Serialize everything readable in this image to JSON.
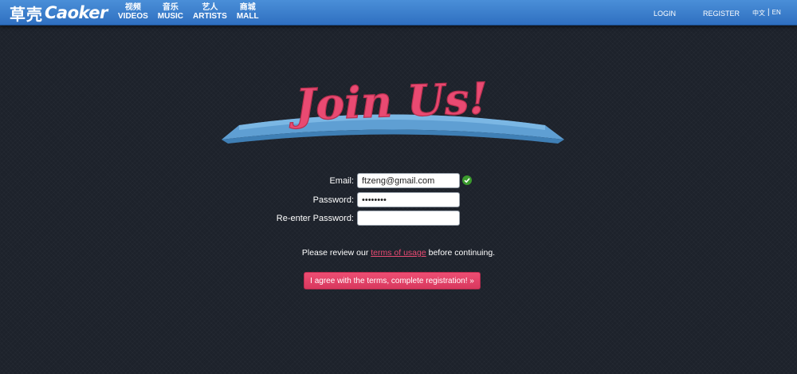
{
  "header": {
    "logo_cn": "草壳",
    "logo_en": "Caoker",
    "nav": [
      {
        "cn": "视频",
        "en": "VIDEOS"
      },
      {
        "cn": "音乐",
        "en": "MUSIC"
      },
      {
        "cn": "艺人",
        "en": "ARTISTS"
      },
      {
        "cn": "商城",
        "en": "MALL"
      }
    ],
    "login": "LOGIN",
    "register": "REGISTER",
    "lang_cn": "中文",
    "lang_sep": "|",
    "lang_en": "EN"
  },
  "banner": {
    "text": "Join Us!"
  },
  "form": {
    "email_label": "Email:",
    "email_value": "ftzeng@gmail.com",
    "password_label": "Password:",
    "password_value": "password",
    "reenter_label": "Re-enter Password:",
    "reenter_value": ""
  },
  "notice": {
    "before": "Please review our ",
    "link": "terms of usage",
    "after": " before continuing."
  },
  "submit_label": "I agree with the terms, complete registration! »",
  "colors": {
    "accent": "#e94a72",
    "header": "#3a7fcf",
    "background": "#1d222b",
    "ribbon": "#6aaedf"
  }
}
